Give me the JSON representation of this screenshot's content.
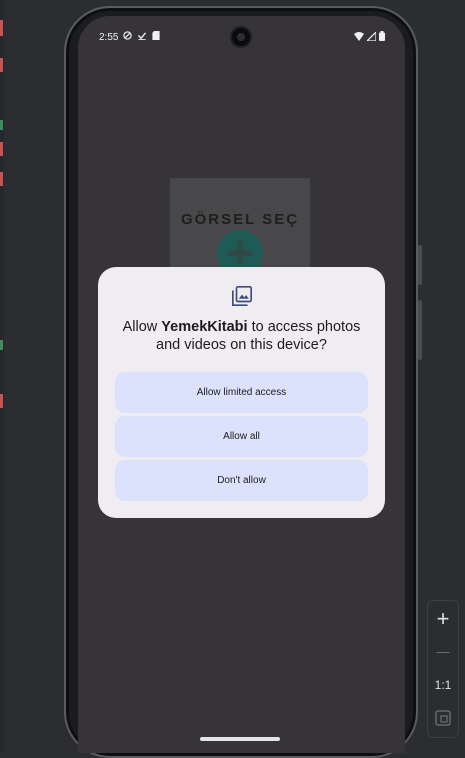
{
  "status_bar": {
    "time": "2:55"
  },
  "app_background": {
    "caption": "GÖRSEL SEÇ"
  },
  "dialog": {
    "title_prefix": "Allow ",
    "app_name": "YemekKitabi",
    "title_suffix": " to access photos and videos on this device?",
    "buttons": [
      {
        "label": "Allow limited access"
      },
      {
        "label": "Allow all"
      },
      {
        "label": "Don't allow"
      }
    ],
    "icon": "photo-library-icon"
  },
  "zoom_toolbar": {
    "zoom_in_label": "+",
    "zoom_out_label": "—",
    "actual_size_label": "1:1",
    "icons": [
      "zoom-in-icon",
      "zoom-out-icon",
      "fit-screen-icon"
    ]
  },
  "colors": {
    "dialog_bg": "#efecf2",
    "button_bg": "#dce2fb",
    "screen_bg": "#363438",
    "ide_bg": "#2b2d30"
  }
}
